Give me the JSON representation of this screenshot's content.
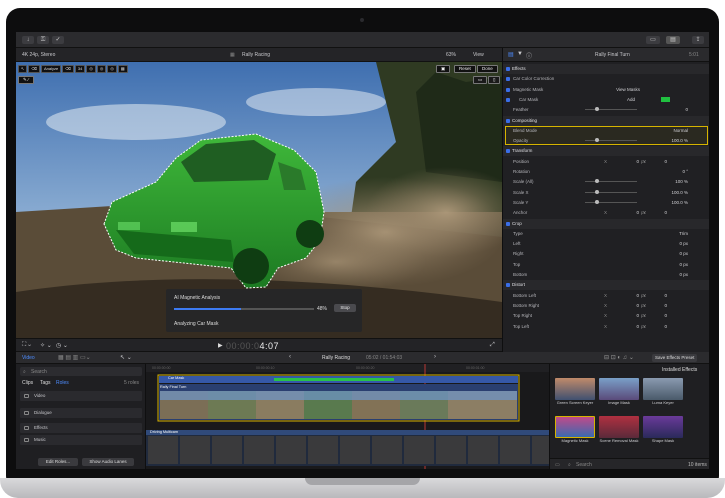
{
  "top": {
    "format": "4K 24p, Stereo",
    "project_title": "Rally Racing",
    "zoom": "63%",
    "view_label": "View",
    "inspector_title": "Rally Final Turn",
    "inspector_time": "5:01"
  },
  "viewer_overlay": {
    "tools": [
      "↖",
      "⌫",
      "Analyze",
      "⌫",
      "34",
      "◎",
      "◎",
      "◎",
      "▦"
    ],
    "reset_label": "Reset",
    "done_label": "Done"
  },
  "analysis": {
    "title": "AI Magnetic Analysis",
    "progress_percent": 48,
    "progress_label": "48%",
    "stop_label": "Stop",
    "status": "Analyzing Car Mask"
  },
  "transport": {
    "timecode_dim": "00:00:0",
    "timecode": "4:07"
  },
  "inspector": {
    "rows": [
      {
        "type": "section",
        "label": "Effects"
      },
      {
        "type": "item",
        "label": "Car Color Correction",
        "check": true
      },
      {
        "type": "item",
        "label": "Magnetic Mask",
        "check": true,
        "right": "View Masks"
      },
      {
        "type": "item",
        "label": "Car Mask",
        "check": true,
        "right": "Add"
      },
      {
        "type": "item",
        "label": "Feather",
        "value": "0"
      },
      {
        "type": "section",
        "label": "Compositing"
      },
      {
        "type": "item",
        "label": "Blend Mode",
        "right": "Normal"
      },
      {
        "type": "item",
        "label": "Opacity",
        "value": "100.0 %"
      },
      {
        "type": "section",
        "label": "Transform"
      },
      {
        "type": "pair",
        "label": "Position",
        "ax1": "X",
        "v1": "0",
        "ax2": "Y",
        "v2": "0"
      },
      {
        "type": "item",
        "label": "Rotation",
        "value": "0 °"
      },
      {
        "type": "item",
        "label": "Scale (All)",
        "value": "100 %"
      },
      {
        "type": "item",
        "label": "Scale X",
        "value": "100.0 %"
      },
      {
        "type": "item",
        "label": "Scale Y",
        "value": "100.0 %"
      },
      {
        "type": "pair",
        "label": "Anchor",
        "ax1": "X",
        "v1": "0",
        "ax2": "Y",
        "v2": "0"
      },
      {
        "type": "section",
        "label": "Crop"
      },
      {
        "type": "item",
        "label": "Type",
        "right": "Trim"
      },
      {
        "type": "item",
        "label": "Left",
        "value": "0 px"
      },
      {
        "type": "item",
        "label": "Right",
        "value": "0 px"
      },
      {
        "type": "item",
        "label": "Top",
        "value": "0 px"
      },
      {
        "type": "item",
        "label": "Bottom",
        "value": "0 px"
      },
      {
        "type": "section",
        "label": "Distort"
      },
      {
        "type": "pair",
        "label": "Bottom Left",
        "ax1": "X",
        "v1": "0",
        "ax2": "Y",
        "v2": "0"
      },
      {
        "type": "pair",
        "label": "Bottom Right",
        "ax1": "X",
        "v1": "0",
        "ax2": "Y",
        "v2": "0"
      },
      {
        "type": "pair",
        "label": "Top Right",
        "ax1": "X",
        "v1": "0",
        "ax2": "Y",
        "v2": "0"
      },
      {
        "type": "pair",
        "label": "Top Left",
        "ax1": "X",
        "v1": "0",
        "ax2": "Y",
        "v2": "0"
      }
    ]
  },
  "lower": {
    "video_tab": "Video",
    "timeline_title": "Rally Racing",
    "timeline_time": "05:02 / 01:54:03",
    "effects_title": "Installed Effects",
    "save_preset": "Save Effects Preset"
  },
  "browser": {
    "search_placeholder": "Search",
    "tabs": [
      "Clips",
      "Tags",
      "Roles"
    ],
    "roles_count": "5 roles",
    "roles": [
      "Video",
      "Dialogue",
      "Effects",
      "Music"
    ],
    "edit_roles": "Edit Roles...",
    "show_audio_lanes": "Show Audio Lanes"
  },
  "timeline": {
    "mask_clip": "Car Mask",
    "main_clip": "Rally Final Turn",
    "audio_clip": "Driving Multicam"
  },
  "effects": {
    "items": [
      "Green Screen Keyer",
      "Image Mask",
      "Luma Keyer",
      "Magnetic Mask",
      "Scene Removal Mask",
      "Shape Mask"
    ],
    "search_placeholder": "Search",
    "count": "10 items"
  },
  "colors": {
    "accent_blue": "#3a6ee8",
    "selection_yellow": "#d6b400",
    "mask_green": "#20c040"
  }
}
